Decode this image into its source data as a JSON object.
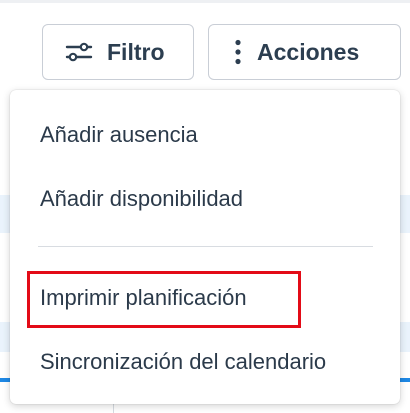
{
  "toolbar": {
    "filter": {
      "label": "Filtro",
      "icon": "sliders-icon"
    },
    "actions": {
      "label": "Acciones",
      "icon": "vertical-dots-icon"
    }
  },
  "menu": {
    "items": [
      {
        "label": "Añadir ausencia"
      },
      {
        "label": "Añadir disponibilidad"
      },
      {
        "label": "Imprimir planificación",
        "highlighted": true
      },
      {
        "label": "Sincronización del calendario"
      }
    ]
  },
  "colors": {
    "highlight": "#e30b17",
    "accent": "#1e88e5",
    "text": "#2b3a4a"
  }
}
